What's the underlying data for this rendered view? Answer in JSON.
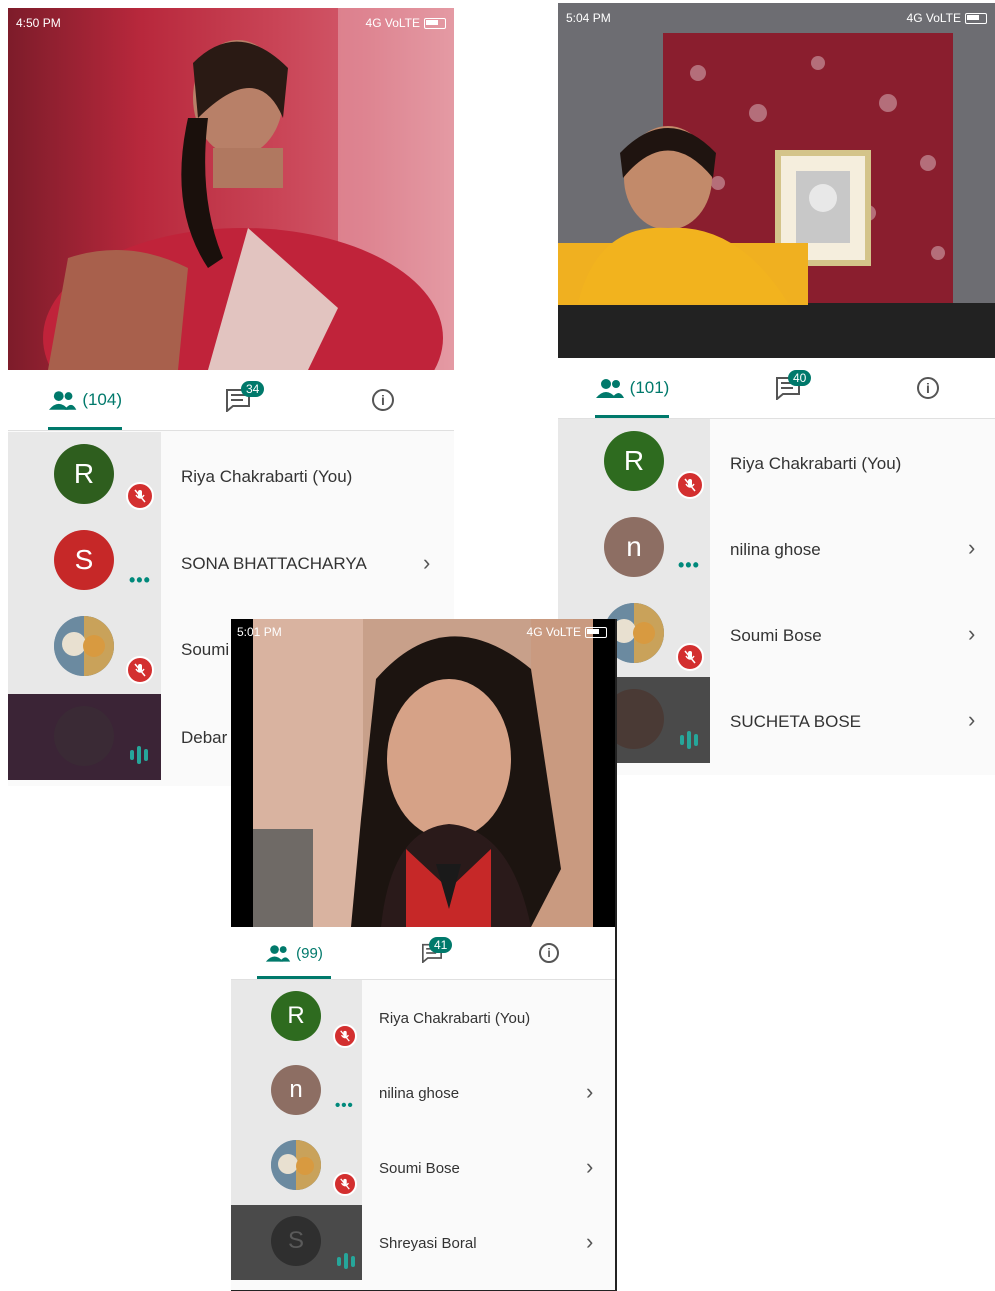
{
  "screens": [
    {
      "status_time": "4:50 PM",
      "status_right": "4G VoLTE",
      "people_count": "(104)",
      "chat_badge": "34",
      "participants": [
        {
          "initial": "R",
          "name": "Riya Chakrabarti (You)",
          "state": "muted",
          "avatar_color": "#2e5e1e"
        },
        {
          "initial": "S",
          "name": "SONA BHATTACHARYA",
          "state": "dots",
          "avatar_color": "#c62828"
        },
        {
          "initial": "",
          "name": "Soumi",
          "state": "muted",
          "avatar_color": "#8da0b0"
        },
        {
          "initial": "",
          "name": "Debar",
          "state": "speaking",
          "avatar_color": "#3a2a35"
        }
      ]
    },
    {
      "status_time": "5:04 PM",
      "status_right": "4G VoLTE",
      "people_count": "(101)",
      "chat_badge": "40",
      "participants": [
        {
          "initial": "R",
          "name": "Riya Chakrabarti (You)",
          "state": "muted",
          "avatar_color": "#2e6b1f"
        },
        {
          "initial": "n",
          "name": "nilina ghose",
          "state": "dots",
          "avatar_color": "#8d6e63"
        },
        {
          "initial": "",
          "name": "Soumi Bose",
          "state": "muted",
          "avatar_color": "#8da0b0"
        },
        {
          "initial": "",
          "name": "SUCHETA BOSE",
          "state": "speaking",
          "avatar_color": "#4a3a35"
        }
      ]
    },
    {
      "status_time": "5:01 PM",
      "status_right": "4G VoLTE",
      "people_count": "(99)",
      "chat_badge": "41",
      "participants": [
        {
          "initial": "R",
          "name": "Riya Chakrabarti (You)",
          "state": "muted",
          "avatar_color": "#2e6b1f"
        },
        {
          "initial": "n",
          "name": "nilina ghose",
          "state": "dots",
          "avatar_color": "#8d6e63"
        },
        {
          "initial": "",
          "name": "Soumi Bose",
          "state": "muted",
          "avatar_color": "#8da0b0"
        },
        {
          "initial": "S",
          "name": "Shreyasi Boral",
          "state": "speaking",
          "avatar_color": "#2f2f2f"
        }
      ]
    }
  ],
  "colors": {
    "accent": "#00796b",
    "mute_red": "#d32f2f",
    "speaking_bg": "#4a4a4a"
  }
}
